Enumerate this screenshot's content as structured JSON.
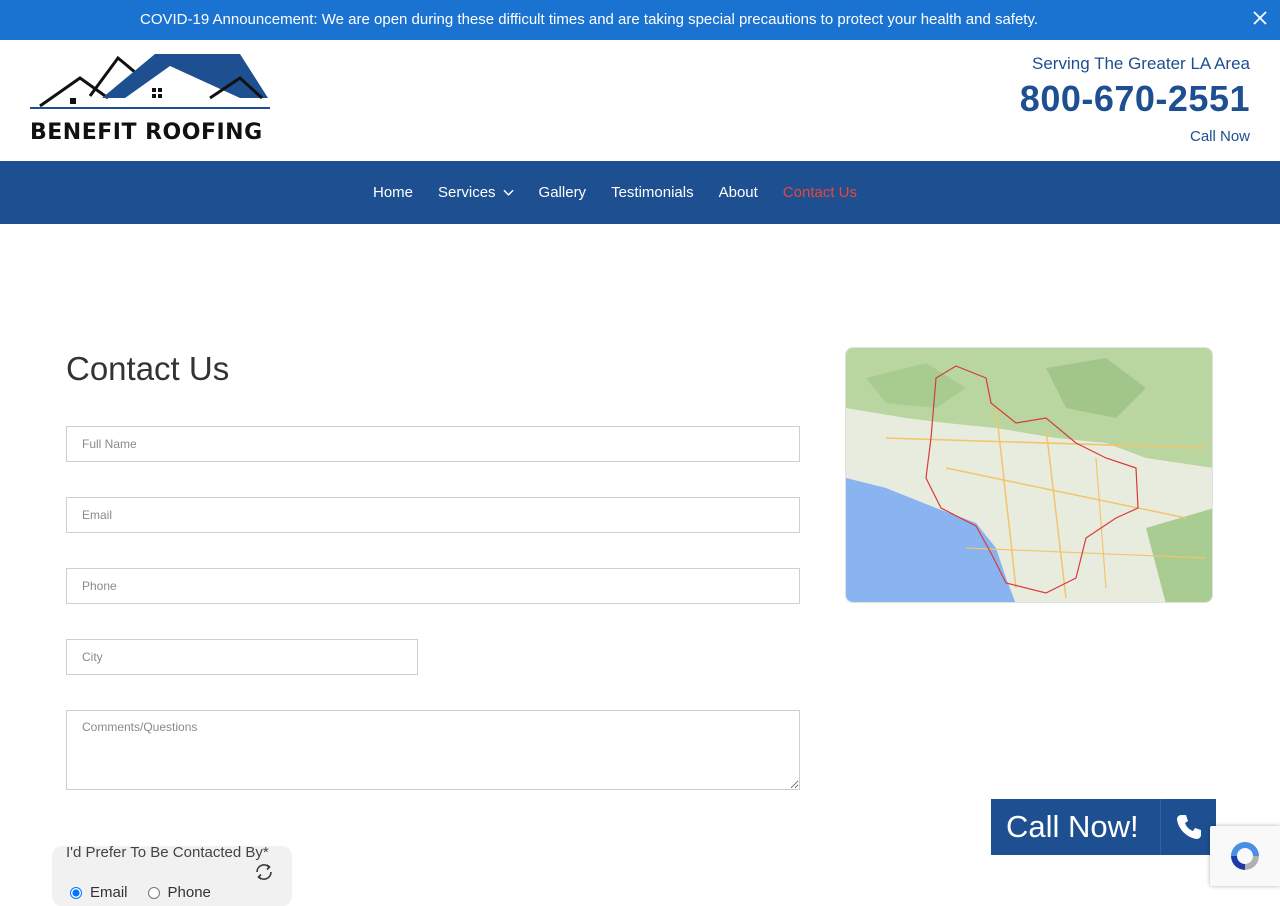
{
  "announcement": {
    "text": "COVID-19 Announcement: We are open during these difficult times and are taking special precautions to protect your health and safety.",
    "close_icon": "close-icon"
  },
  "header": {
    "logo_text": "BENEFIT ROOFING",
    "serving": "Serving The Greater LA Area",
    "phone": "800-670-2551",
    "call_now": "Call Now"
  },
  "nav": {
    "items": [
      {
        "label": "Home"
      },
      {
        "label": "Services",
        "icon": "chevron-down-icon"
      },
      {
        "label": "Gallery"
      },
      {
        "label": "Testimonials"
      },
      {
        "label": "About"
      },
      {
        "label": "Contact Us",
        "active": true
      }
    ]
  },
  "contact": {
    "title": "Contact Us",
    "full_name_placeholder": "Full Name",
    "email_placeholder": "Email",
    "phone_placeholder": "Phone",
    "city_placeholder": "City",
    "comments_placeholder": "Comments/Questions",
    "preference_label": "I'd Prefer To Be Contacted By*",
    "preference_options": [
      "Email",
      "Phone"
    ],
    "preference_selected": "Email"
  },
  "float_call": {
    "label": "Call Now!",
    "icon": "phone-icon"
  },
  "colors": {
    "brand_blue": "#1d4f91",
    "announce_blue": "#1a73d1",
    "active_red": "#e8473c"
  }
}
